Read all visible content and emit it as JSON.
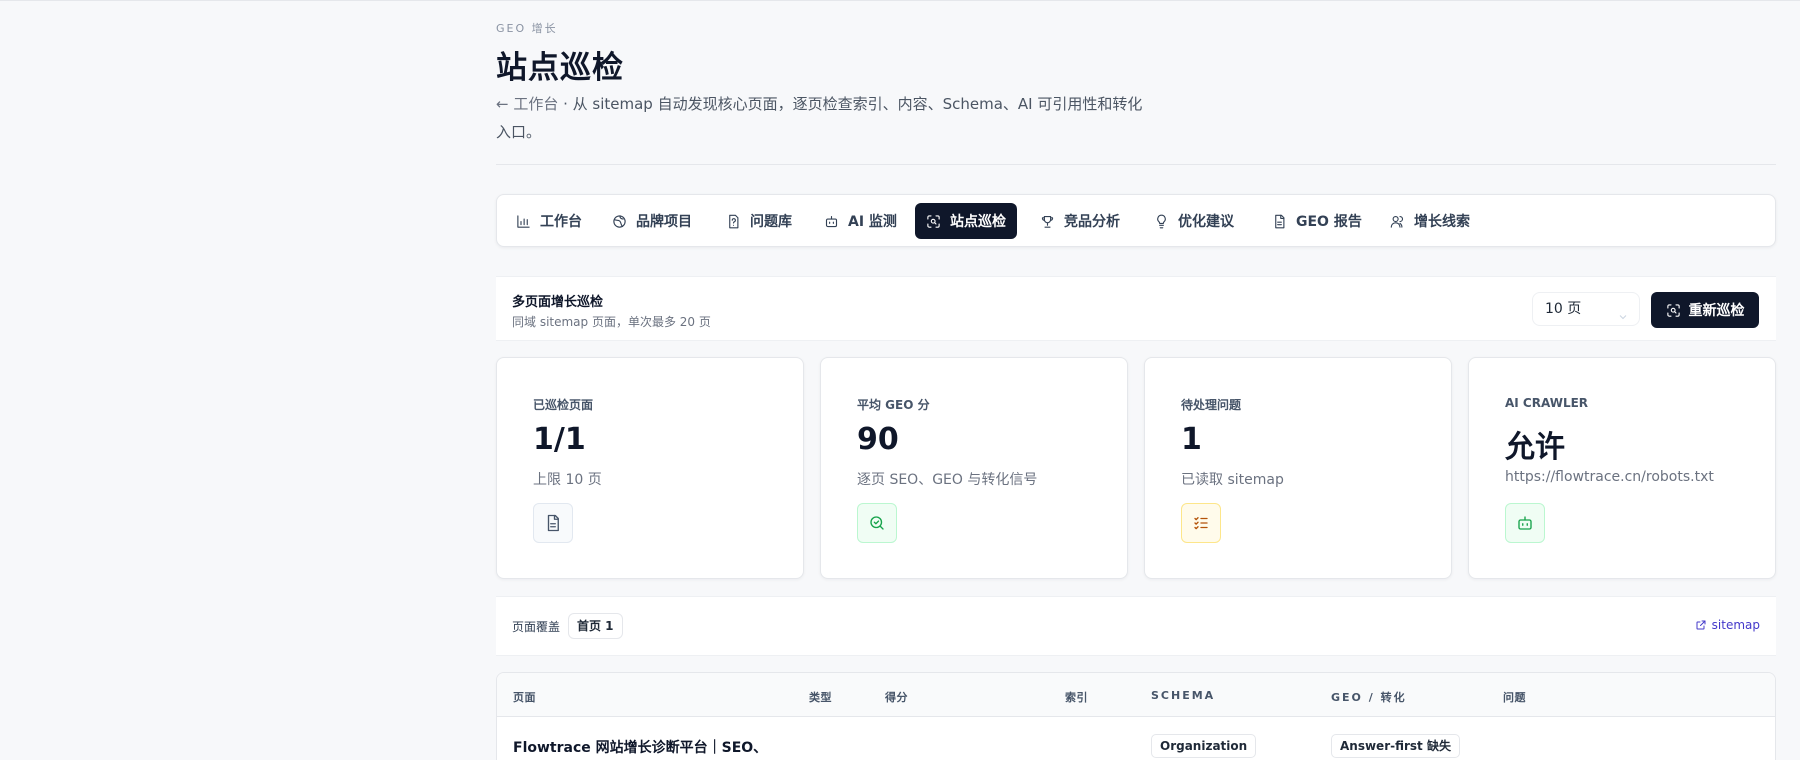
{
  "header": {
    "eyebrow": "GEO 增长",
    "title": "站点巡检",
    "back_link": "← 工作台",
    "description": " · 从 sitemap 自动发现核心页面，逐页检查索引、内容、Schema、AI 可引用性和转化入口。"
  },
  "nav": {
    "tabs": [
      {
        "label": "工作台",
        "icon": "bar-chart-icon",
        "active": false
      },
      {
        "label": "品牌项目",
        "icon": "globe-icon",
        "active": false
      },
      {
        "label": "问题库",
        "icon": "question-file-icon",
        "active": false
      },
      {
        "label": "AI 监测",
        "icon": "bot-icon",
        "active": false
      },
      {
        "label": "站点巡检",
        "icon": "scan-icon",
        "active": true
      },
      {
        "label": "竞品分析",
        "icon": "trophy-icon",
        "active": false
      },
      {
        "label": "优化建议",
        "icon": "lightbulb-icon",
        "active": false
      },
      {
        "label": "GEO 报告",
        "icon": "file-text-icon",
        "active": false
      },
      {
        "label": "增长线索",
        "icon": "users-icon",
        "active": false
      }
    ]
  },
  "section": {
    "title": "多页面增长巡检",
    "subtitle": "同域 sitemap 页面，单次最多 20 页",
    "select_value": "10 页",
    "rescan_label": "重新巡检"
  },
  "stats": [
    {
      "label": "已巡检页面",
      "value": "1/1",
      "hint": "上限 10 页",
      "icon": "document-icon",
      "accent": "#475569",
      "bg": "#f8fafc",
      "border": "#e2e8f0"
    },
    {
      "label": "平均 GEO 分",
      "value": "90",
      "hint": "逐页 SEO、GEO 与转化信号",
      "icon": "search-check-icon",
      "accent": "#16a34a",
      "bg": "#f0fdf4",
      "border": "#bbf7d0"
    },
    {
      "label": "待处理问题",
      "value": "1",
      "hint": "已读取 sitemap",
      "icon": "checklist-icon",
      "accent": "#b45309",
      "bg": "#fffbeb",
      "border": "#fde68a"
    },
    {
      "label": "AI CRAWLER",
      "value": "允许",
      "hint": "https://flowtrace.cn/robots.txt",
      "icon": "bot-icon",
      "accent": "#16a34a",
      "bg": "#f0fdf4",
      "border": "#bbf7d0"
    }
  ],
  "coverage": {
    "label": "页面覆盖",
    "chip": "首页 1",
    "link": "sitemap"
  },
  "table": {
    "columns": [
      "页面",
      "类型",
      "得分",
      "索引",
      "SCHEMA",
      "GEO / 转化",
      "问题"
    ],
    "rows": [
      {
        "page": "Flowtrace 网站增长诊断平台｜SEO、",
        "schema": "Organization",
        "geo": "Answer-first 缺失"
      }
    ]
  },
  "colors": {
    "primary": "#0f172a",
    "link": "#4338ca"
  }
}
